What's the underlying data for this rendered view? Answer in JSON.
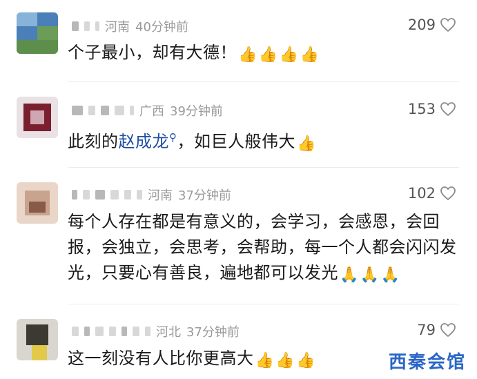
{
  "comments": [
    {
      "location": "河南",
      "time": "40分钟前",
      "likes": "209",
      "text": "个子最小，却有大德！",
      "emoji_icon": "thumbs-up-icon",
      "emoji_count": 4,
      "avatar_colors": [
        "#4a7fb8",
        "#6b9c58",
        "#87b3d9"
      ]
    },
    {
      "location": "广西",
      "time": "39分钟前",
      "likes": "153",
      "text_before": "此刻的",
      "text_highlight": "赵成龙",
      "text_after": "，如巨人般伟大",
      "emoji_icon": "thumbs-up-icon",
      "emoji_count": 1,
      "avatar_colors": [
        "#e9e1e4",
        "#7a1f2e",
        "#cfa7b1"
      ]
    },
    {
      "location": "河南",
      "time": "37分钟前",
      "likes": "102",
      "text": "每个人存在都是有意义的，会学习，会感恩，会回报，会独立，会思考，会帮助，每一个人都会闪闪发光，只要心有善良，遍地都可以发光",
      "emoji_icon": "praying-hands-icon",
      "emoji_count": 3,
      "avatar_colors": [
        "#c8a48e",
        "#8a5a48",
        "#e9d6c9"
      ]
    },
    {
      "location": "河北",
      "time": "37分钟前",
      "likes": "79",
      "text": "这一刻没有人比你更高大",
      "emoji_icon": "thumbs-up-icon",
      "emoji_count": 3,
      "avatar_colors": [
        "#d9d6cf",
        "#3b3a32",
        "#e2c94a"
      ]
    }
  ],
  "watermark": "西秦会馆",
  "colors": {
    "meta_gray": "#9a9a9a",
    "highlight_blue": "#1f4fa3",
    "watermark_blue": "#2a66c7"
  }
}
